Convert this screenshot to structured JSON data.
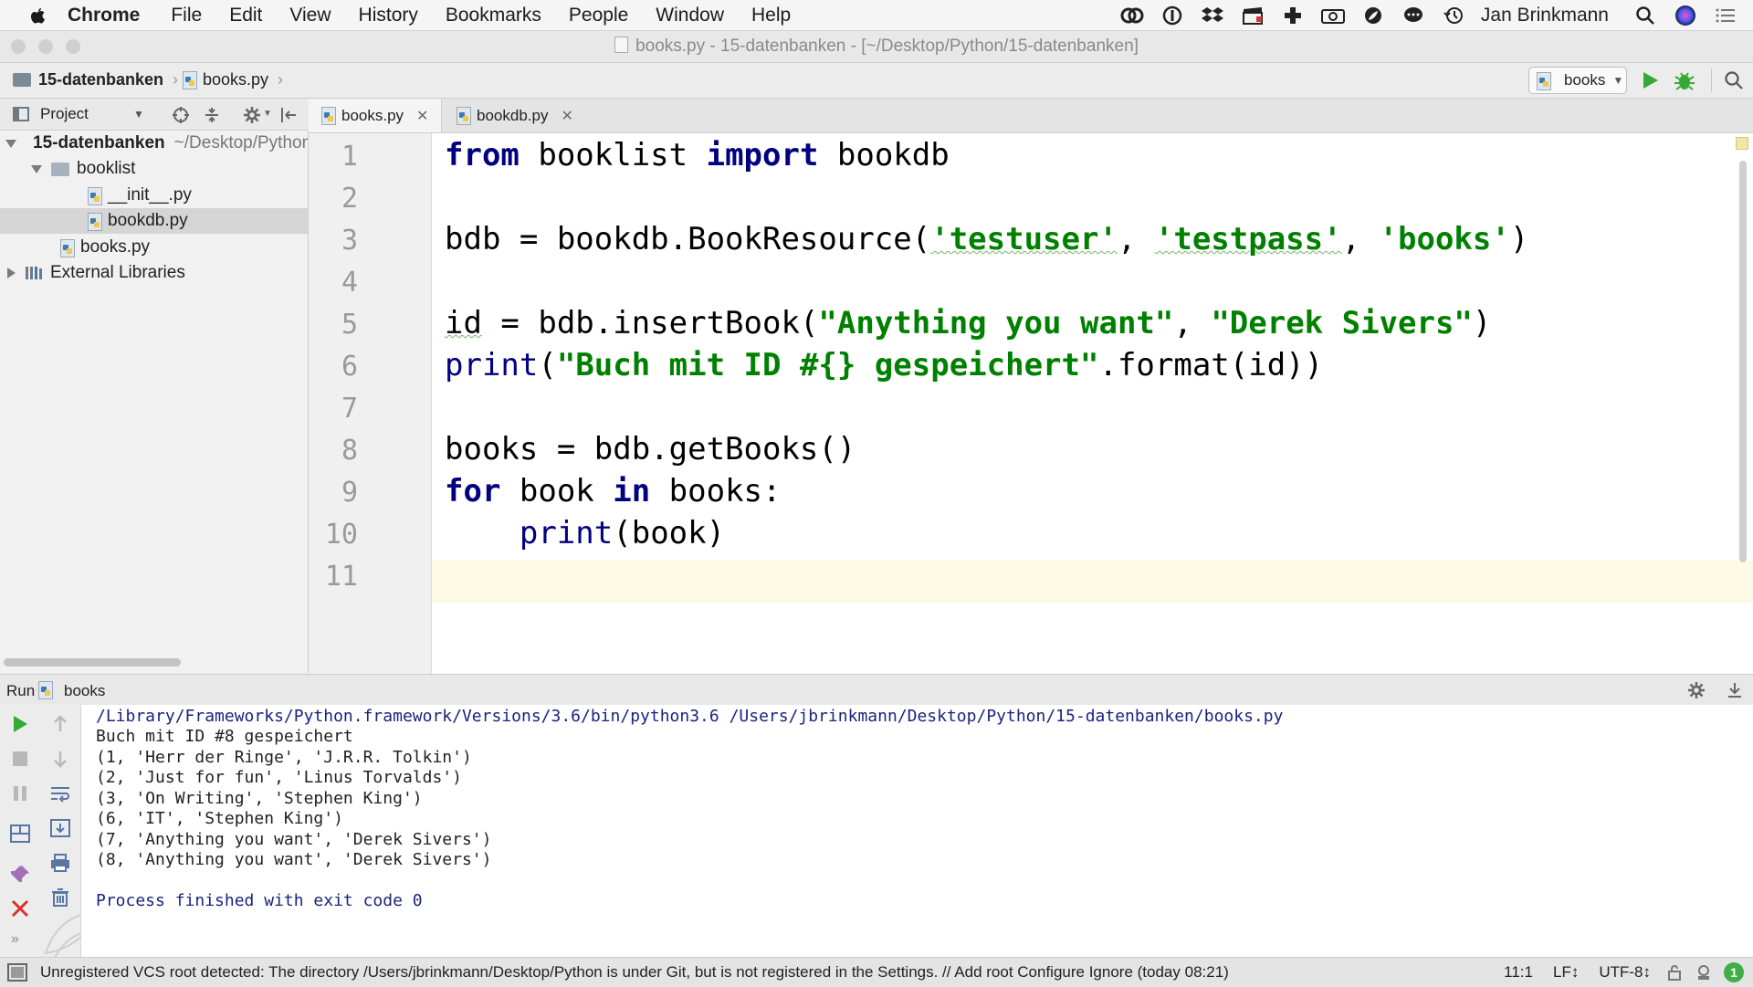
{
  "menubar": {
    "app": "Chrome",
    "items": [
      "File",
      "Edit",
      "View",
      "History",
      "Bookmarks",
      "People",
      "Window",
      "Help"
    ],
    "user": "Jan Brinkmann"
  },
  "window": {
    "title": "books.py - 15-datenbanken - [~/Desktop/Python/15-datenbanken]"
  },
  "navbar": {
    "crumb_project": "15-datenbanken",
    "crumb_file": "books.py",
    "run_config": "books"
  },
  "project_panel": {
    "header": "Project",
    "tree": [
      {
        "label": "15-datenbanken",
        "suffix": "~/Desktop/Python/15-datenbanken"
      },
      {
        "label": "booklist"
      },
      {
        "label": "__init__.py"
      },
      {
        "label": "bookdb.py"
      },
      {
        "label": "books.py"
      },
      {
        "label": "External Libraries"
      }
    ]
  },
  "tabs": [
    {
      "label": "books.py"
    },
    {
      "label": "bookdb.py"
    }
  ],
  "editor": {
    "line_numbers": [
      "1",
      "2",
      "3",
      "4",
      "5",
      "6",
      "7",
      "8",
      "9",
      "10",
      "11"
    ],
    "tokens": {
      "l1": [
        "from",
        " booklist ",
        "import",
        " bookdb"
      ],
      "l3": [
        "bdb = bookdb.BookResource(",
        "'testuser'",
        ", ",
        "'testpass'",
        ", ",
        "'books'",
        ")"
      ],
      "l5": [
        "id",
        " = bdb.insertBook(",
        "\"Anything you want\"",
        ", ",
        "\"Derek Sivers\"",
        ")"
      ],
      "l6": [
        "print",
        "(",
        "\"Buch mit ID #{} gespeichert\"",
        ".format(id))"
      ],
      "l8": [
        "books = bdb.getBooks()"
      ],
      "l9": [
        "for",
        " book ",
        "in",
        " books:"
      ],
      "l10": [
        "    ",
        "print",
        "(book)"
      ]
    }
  },
  "run_panel": {
    "label": "Run",
    "config": "books",
    "output": [
      "/Library/Frameworks/Python.framework/Versions/3.6/bin/python3.6 /Users/jbrinkmann/Desktop/Python/15-datenbanken/books.py",
      "Buch mit ID #8 gespeichert",
      "(1, 'Herr der Ringe', 'J.R.R. Tolkin')",
      "(2, 'Just for fun', 'Linus Torvalds')",
      "(3, 'On Writing', 'Stephen King')",
      "(6, 'IT', 'Stephen King')",
      "(7, 'Anything you want', 'Derek Sivers')",
      "(8, 'Anything you want', 'Derek Sivers')",
      "",
      "Process finished with exit code 0"
    ]
  },
  "statusbar": {
    "message": "Unregistered VCS root detected: The directory /Users/jbrinkmann/Desktop/Python is under Git, but is not registered in the Settings. // Add root  Configure  Ignore (today 08:21)",
    "position": "11:1",
    "line_sep": "LF↕",
    "encoding": "UTF-8↕",
    "badge": "1"
  },
  "colors": {
    "keyword": "#000080",
    "string": "#008000",
    "run_green": "#36a936",
    "stop_red": "#d9302c",
    "current_line": "#fdfbe5"
  }
}
